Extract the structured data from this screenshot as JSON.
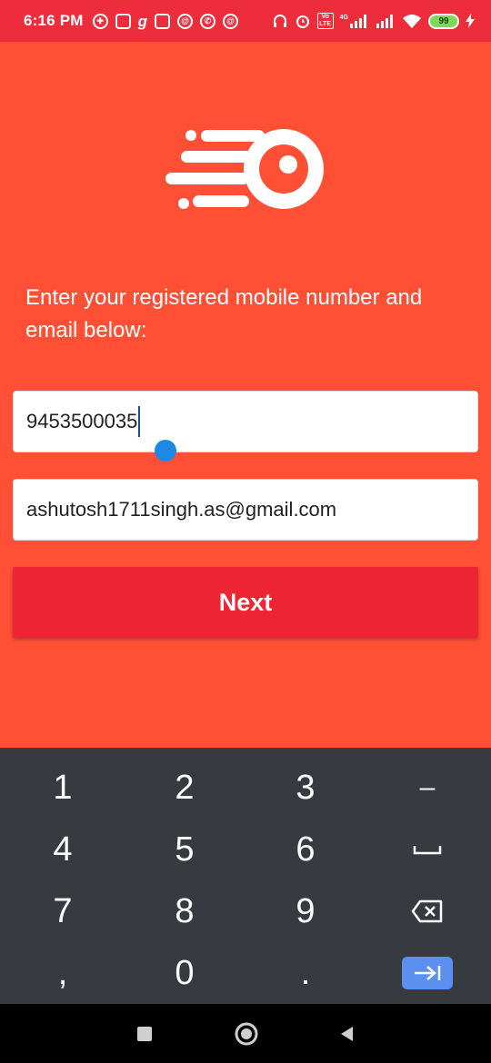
{
  "status_bar": {
    "time": "6:16 PM",
    "network_label": "4G",
    "volte_label": "Vo LTE",
    "battery": "99",
    "left_icons": [
      "hotspot-icon",
      "instagram-icon",
      "g-icon",
      "news-icon",
      "at-icon",
      "whatsapp-icon",
      "at-icon"
    ],
    "right_icons": [
      "headphones-icon",
      "alarm-icon",
      "volte-icon",
      "signal-icon",
      "signal-icon",
      "wifi-icon",
      "battery-icon",
      "charging-icon"
    ]
  },
  "app": {
    "prompt": "Enter your registered mobile number and email below:",
    "mobile": {
      "value": "9453500035"
    },
    "email": {
      "value": "ashutosh1711singh.as@gmail.com"
    },
    "next_label": "Next",
    "colors": {
      "background": "#FF5036",
      "button": "#EE2535",
      "status_bar": "#EE2D3C",
      "keyboard": "#373B40",
      "accent": "#1E88E5"
    }
  },
  "keyboard": {
    "rows": [
      [
        "1",
        "2",
        "3",
        "–"
      ],
      [
        "4",
        "5",
        "6",
        "space"
      ],
      [
        "7",
        "8",
        "9",
        "backspace"
      ],
      [
        ",",
        "0",
        ".",
        "tab"
      ]
    ]
  }
}
